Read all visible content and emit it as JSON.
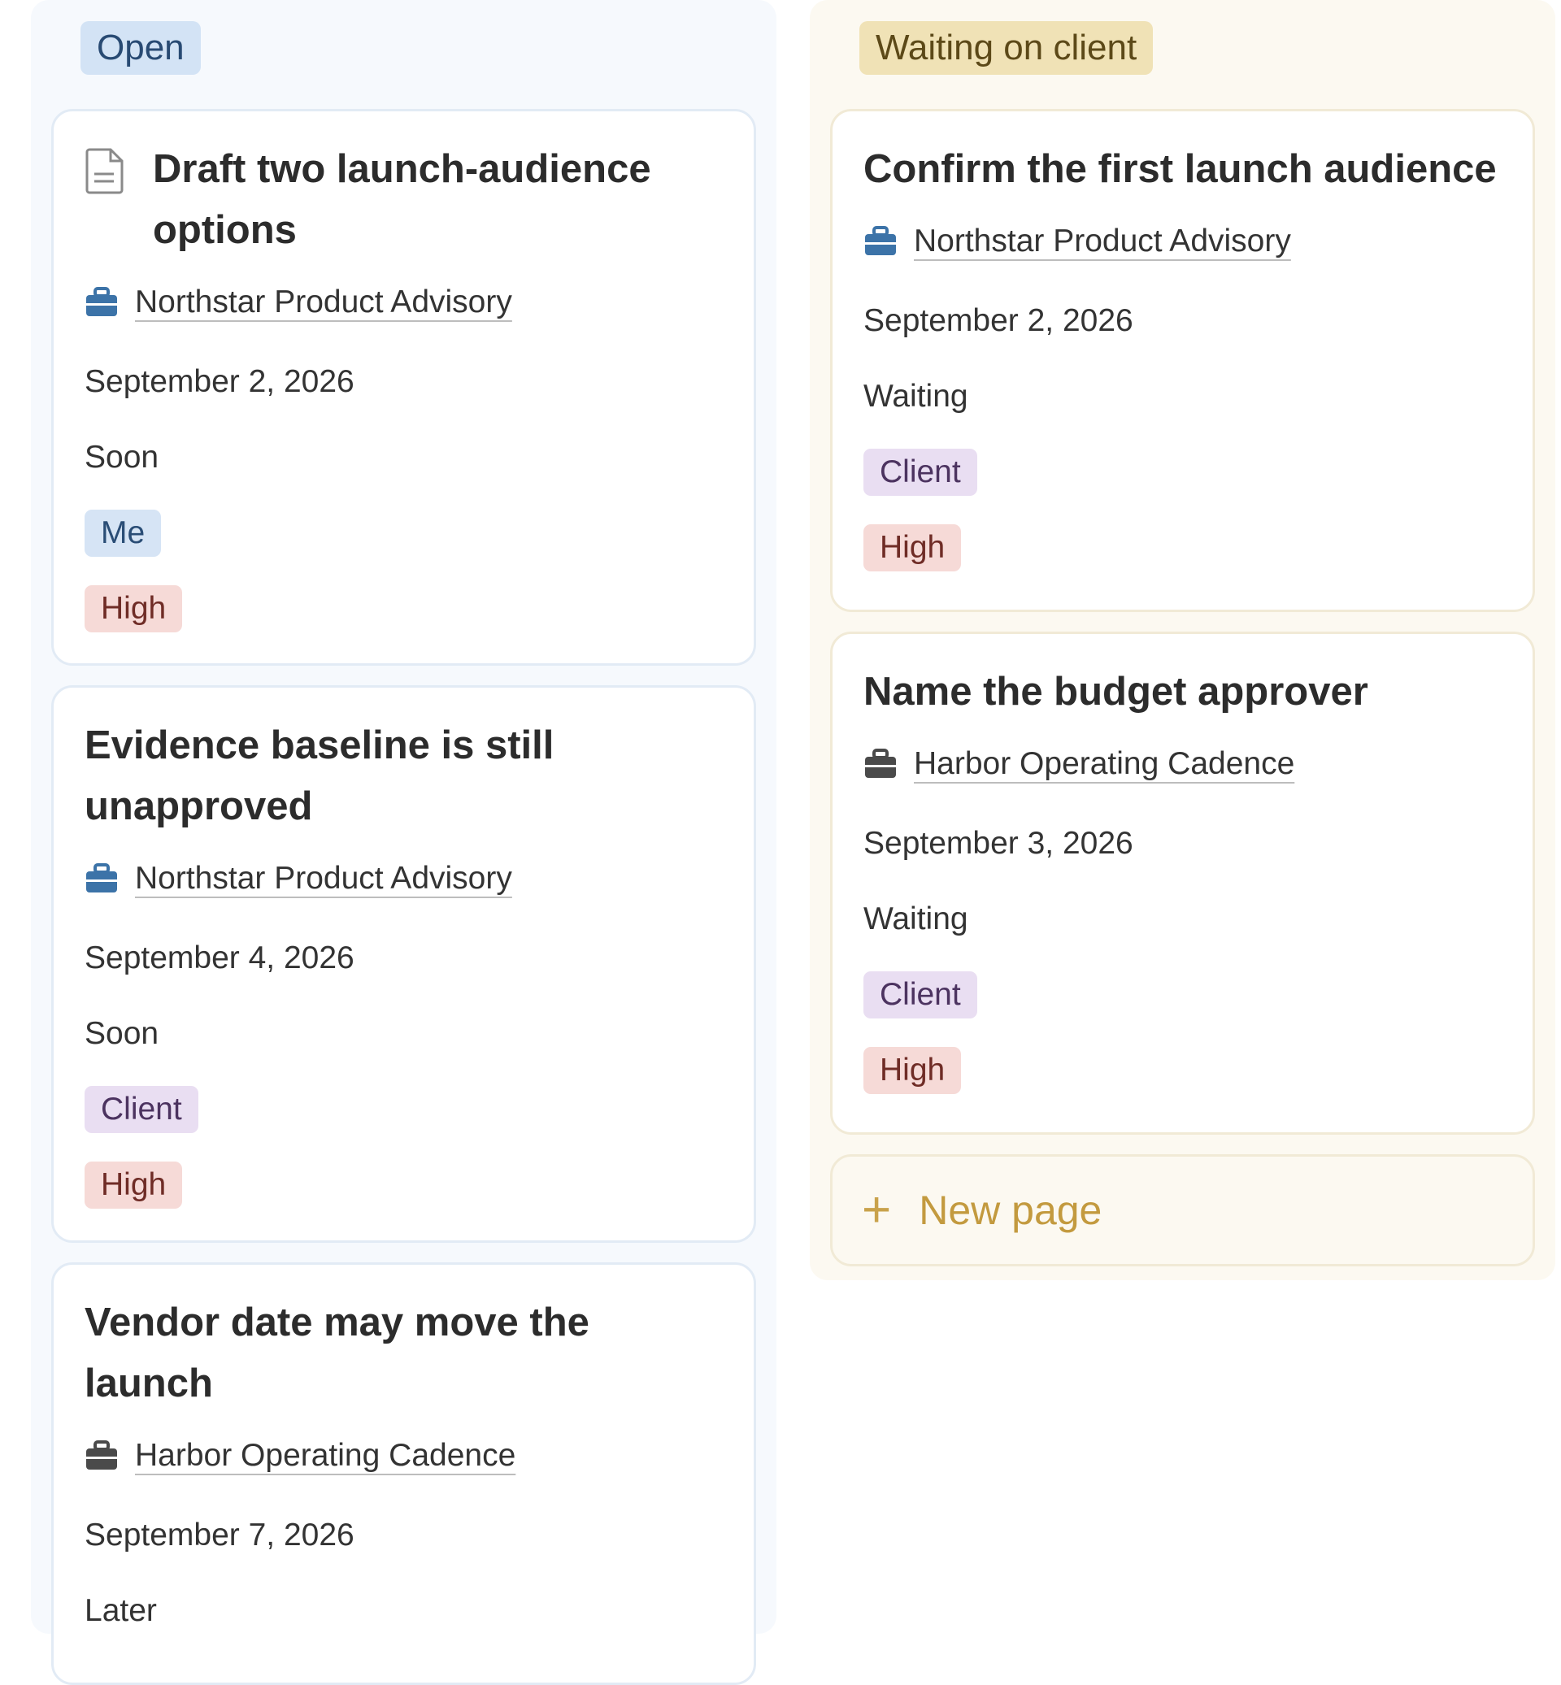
{
  "columns": [
    {
      "name": "Open",
      "cards": [
        {
          "title": "Draft two launch-audience options",
          "project": "Northstar Product Advisory",
          "date": "September 2, 2026",
          "timing": "Soon",
          "owner": "Me",
          "priority": "High"
        },
        {
          "title": "Evidence baseline is still unapproved",
          "project": "Northstar Product Advisory",
          "date": "September 4, 2026",
          "timing": "Soon",
          "owner": "Client",
          "priority": "High"
        },
        {
          "title": "Vendor date may move the launch",
          "project": "Harbor Operating Cadence",
          "date": "September 7, 2026",
          "timing": "Later"
        }
      ]
    },
    {
      "name": "Waiting on client",
      "cards": [
        {
          "title": "Confirm the first launch audience",
          "project": "Northstar Product Advisory",
          "date": "September 2, 2026",
          "timing": "Waiting",
          "owner": "Client",
          "priority": "High"
        },
        {
          "title": "Name the budget approver",
          "project": "Harbor Operating Cadence",
          "date": "September 3, 2026",
          "timing": "Waiting",
          "owner": "Client",
          "priority": "High"
        }
      ],
      "new_page_label": "New page"
    }
  ],
  "icons": {
    "page": "document-icon",
    "project_northstar": "briefcase-icon",
    "project_harbor": "briefcase-icon",
    "new": "plus-icon"
  },
  "colors": {
    "northstar_icon": "#3c73a8",
    "harbor_icon": "#4a4a4a",
    "open_pill": "#d3e3f5",
    "waiting_pill": "#f0e2b6"
  }
}
